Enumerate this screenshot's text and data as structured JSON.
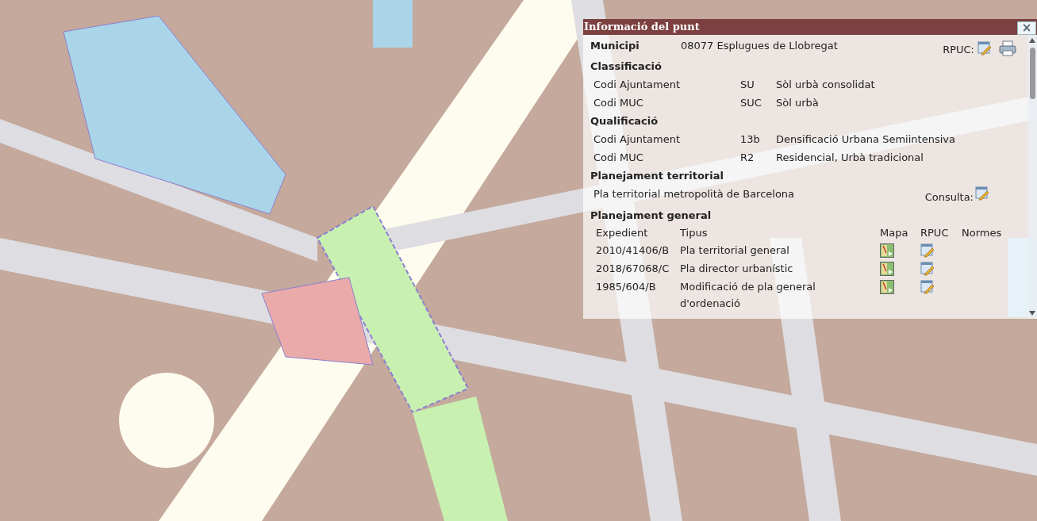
{
  "popup": {
    "title": "Informació del punt",
    "close": "×",
    "municipi": {
      "label": "Municipi",
      "value": "08077 Esplugues de Llobregat",
      "rpuc_label": "RPUC:"
    },
    "classificacio": {
      "heading": "Classificació",
      "rows": [
        {
          "label": "Codi Ajuntament",
          "code": "SU",
          "description": "Sòl urbà consolidat"
        },
        {
          "label": "Codi MUC",
          "code": "SUC",
          "description": "Sòl urbà"
        }
      ]
    },
    "qualificacio": {
      "heading": "Qualificació",
      "rows": [
        {
          "label": "Codi Ajuntament",
          "code": "13b",
          "description": "Densificació Urbana Semiintensiva"
        },
        {
          "label": "Codi MUC",
          "code": "R2",
          "description": "Residencial, Urbà tradicional"
        }
      ]
    },
    "planejament_territorial": {
      "heading": "Planejament territorial",
      "name": "Pla territorial metropolità de Barcelona",
      "consulta_label": "Consulta:"
    },
    "planejament_general": {
      "heading": "Planejament general",
      "columns": [
        "Expedient",
        "Tipus",
        "Mapa",
        "RPUC",
        "Normes"
      ],
      "rows": [
        {
          "expedient": "2010/41406/B",
          "tipus": "Pla territorial general"
        },
        {
          "expedient": "2018/67068/C",
          "tipus": "Pla director urbanístic"
        },
        {
          "expedient": "1985/604/B",
          "tipus": "Modificació de pla general d'ordenació"
        }
      ]
    }
  }
}
